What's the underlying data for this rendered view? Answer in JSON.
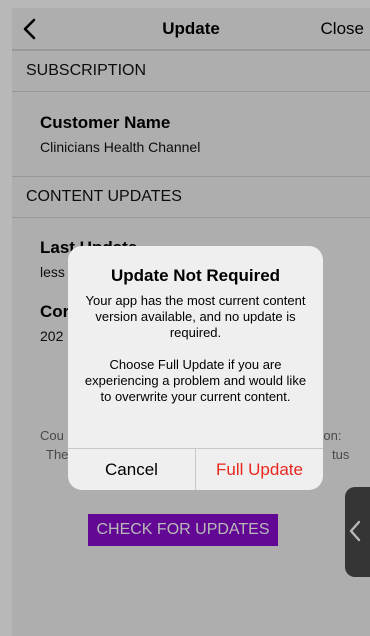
{
  "navbar": {
    "title": "Update",
    "close_label": "Close",
    "back_icon": "chevron-left-icon"
  },
  "subscription": {
    "header": "SUBSCRIPTION",
    "customer_title": "Customer Name",
    "customer_value": "Clinicians Health Channel"
  },
  "content_updates": {
    "header": "CONTENT UPDATES",
    "last_update_title": "Last Update",
    "last_update_value": "less",
    "second_title": "Cor",
    "second_value": "202"
  },
  "footnote": {
    "line1_left": "Cou",
    "line1_right": "sion:",
    "line2_left": "The",
    "line2_right": "tus"
  },
  "check_button": {
    "label": "CHECK FOR UPDATES",
    "color": "#8a0ccf"
  },
  "alert": {
    "title": "Update Not Required",
    "message_1": "Your app has the most current content version available, and no update is required.",
    "message_2": "Choose Full Update if you are experiencing a problem and would like to overwrite your current content.",
    "cancel_label": "Cancel",
    "full_update_label": "Full Update",
    "destructive_color": "#e8271f"
  },
  "side_handle_icon": "chevron-left-icon"
}
